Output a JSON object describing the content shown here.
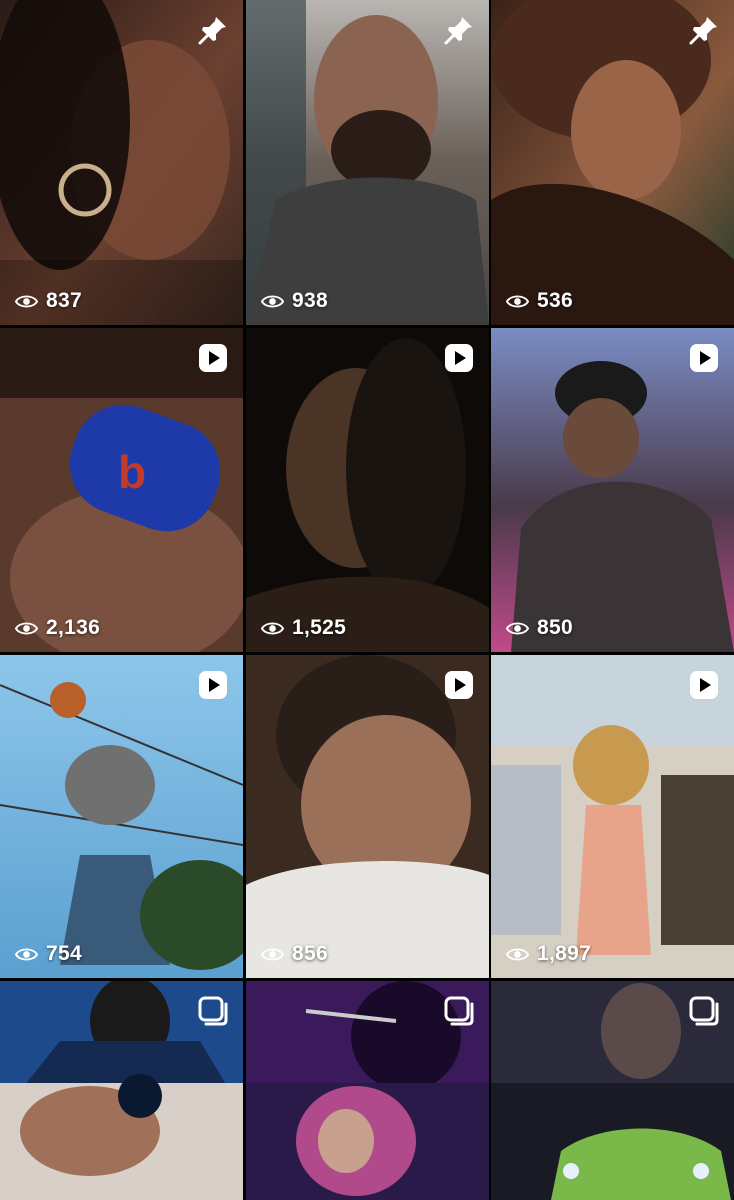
{
  "grid": {
    "tiles": [
      {
        "views": "837",
        "badge_icon": "pin-icon",
        "colors": [
          "#2a1a16",
          "#6b4030",
          "#3a2820"
        ]
      },
      {
        "views": "938",
        "badge_icon": "pin-icon",
        "colors": [
          "#b9b6b2",
          "#4a4745",
          "#6a5f58"
        ]
      },
      {
        "views": "536",
        "badge_icon": "pin-icon",
        "colors": [
          "#3a2218",
          "#8a5a3e",
          "#1e3a2a"
        ]
      },
      {
        "views": "2,136",
        "badge_icon": "reel-icon",
        "colors": [
          "#5a3a2c",
          "#1d3aa8",
          "#2a1a14"
        ]
      },
      {
        "views": "1,525",
        "badge_icon": "reel-icon",
        "colors": [
          "#1a1410",
          "#4a3426",
          "#0e0a08"
        ]
      },
      {
        "views": "850",
        "badge_icon": "reel-icon",
        "colors": [
          "#7a8cc4",
          "#4a3a4a",
          "#c04a8a"
        ]
      },
      {
        "views": "754",
        "badge_icon": "reel-icon",
        "colors": [
          "#8ec6ea",
          "#4a6a8a",
          "#2a4a5a"
        ]
      },
      {
        "views": "856",
        "badge_icon": "reel-icon",
        "colors": [
          "#3a2a20",
          "#9a7058",
          "#e8e6e2"
        ]
      },
      {
        "views": "1,897",
        "badge_icon": "reel-icon",
        "colors": [
          "#d6d0c4",
          "#e8a48a",
          "#4a4036"
        ]
      },
      {
        "views": "",
        "badge_icon": "carousel-icon",
        "colors": [
          "#1c4a8a",
          "#142a50",
          "#0a1830"
        ]
      },
      {
        "views": "",
        "badge_icon": "carousel-icon",
        "colors": [
          "#3a1a5a",
          "#b04a8a",
          "#1a0a2a"
        ]
      },
      {
        "views": "",
        "badge_icon": "carousel-icon",
        "colors": [
          "#2a2a3a",
          "#5a4a4a",
          "#1a1a24"
        ]
      }
    ],
    "colors": {
      "text": "#ffffff",
      "background": "#000000"
    }
  }
}
